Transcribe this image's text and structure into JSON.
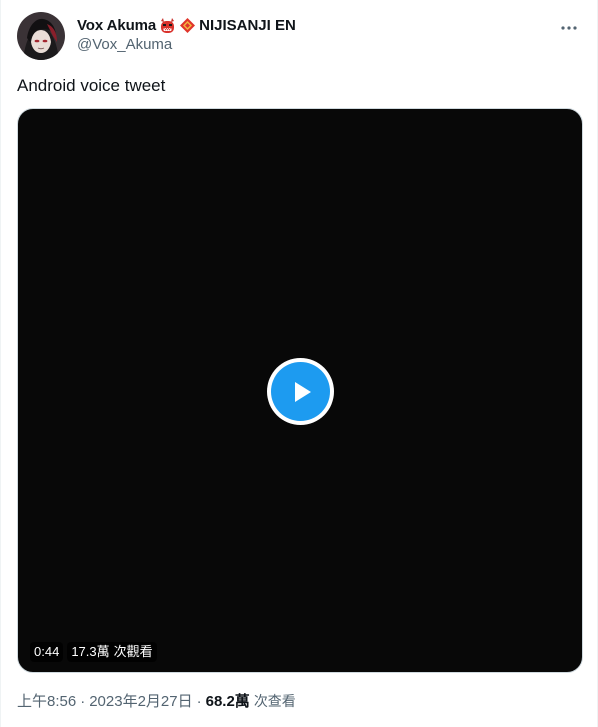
{
  "author": {
    "display_name": "Vox Akuma",
    "affiliation": "NIJISANJI EN",
    "handle": "@Vox_Akuma",
    "avatar_icon": "avatar-image",
    "emoji_icons": [
      "demon-mask-emoji-icon",
      "red-diamond-emoji-icon"
    ]
  },
  "more_icon": "more-horizontal-icon",
  "tweet": {
    "text": "Android voice tweet"
  },
  "video": {
    "duration": "0:44",
    "views_count": "17.3萬",
    "views_label": "次觀看",
    "play_icon": "play-icon"
  },
  "meta": {
    "time": "上午8:56",
    "separator": "·",
    "date": "2023年2月27日",
    "views_count": "68.2萬",
    "views_label": "次查看"
  },
  "colors": {
    "accent": "#1d9bf0",
    "text_primary": "#0f1419",
    "text_secondary": "#536471",
    "video_bg": "#080808"
  }
}
